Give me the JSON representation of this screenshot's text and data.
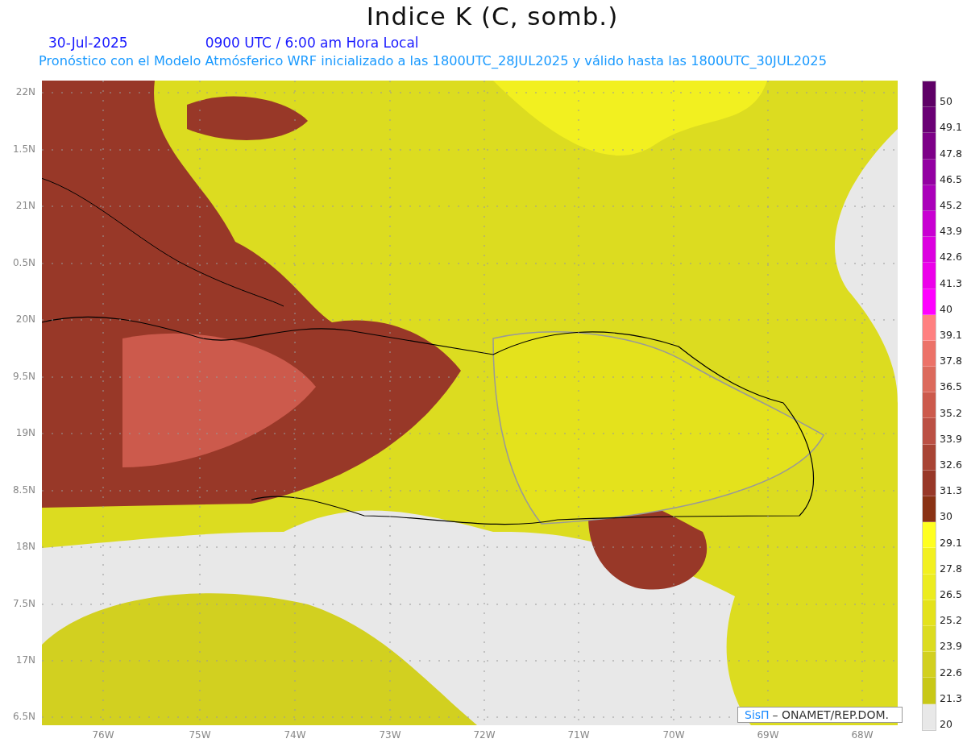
{
  "title": "Indice K (C, somb.)",
  "date": "30-Jul-2025",
  "time": "0900 UTC / 6:00 am Hora Local",
  "subtitle": "Pronóstico con el Modelo Atmósferico WRF inicializado a las 1800UTC_28JUL2025 y válido hasta las  1800UTC_30JUL2025",
  "y_ticks": [
    "22N",
    "1.5N",
    "21N",
    "0.5N",
    "20N",
    "9.5N",
    "19N",
    "8.5N",
    "18N",
    "7.5N",
    "17N",
    "6.5N"
  ],
  "x_ticks": [
    "76W",
    "75W",
    "74W",
    "73W",
    "72W",
    "71W",
    "70W",
    "69W",
    "68W"
  ],
  "credit": {
    "brand": "SisΠ",
    "text": "– ONAMET/REP.DOM."
  },
  "legend": {
    "bins": [
      {
        "color": "#5e0066"
      },
      {
        "color": "#6a0075"
      },
      {
        "color": "#7d0088"
      },
      {
        "color": "#9300a2"
      },
      {
        "color": "#aa00ba"
      },
      {
        "color": "#c800d2"
      },
      {
        "color": "#dc00e0"
      },
      {
        "color": "#ec00ea"
      },
      {
        "color": "#ff00ff"
      },
      {
        "color": "#ff8080"
      },
      {
        "color": "#ec7268"
      },
      {
        "color": "#dc6a5c"
      },
      {
        "color": "#cc5a4c"
      },
      {
        "color": "#bb5044"
      },
      {
        "color": "#a84434"
      },
      {
        "color": "#983828"
      },
      {
        "color": "#8a3214"
      },
      {
        "color": "#ffff20"
      },
      {
        "color": "#f2f020"
      },
      {
        "color": "#ecec20"
      },
      {
        "color": "#e4e21c"
      },
      {
        "color": "#dcdc20"
      },
      {
        "color": "#d2d020"
      },
      {
        "color": "#c8c818"
      },
      {
        "color": "#e8e8e8"
      }
    ],
    "labels": [
      "50",
      "49.1",
      "47.8",
      "46.5",
      "45.2",
      "43.9",
      "42.6",
      "41.3",
      "40",
      "39.1",
      "37.8",
      "36.5",
      "35.2",
      "33.9",
      "32.6",
      "31.3",
      "30",
      "29.1",
      "27.8",
      "26.5",
      "25.2",
      "23.9",
      "22.6",
      "21.3",
      "20"
    ]
  }
}
